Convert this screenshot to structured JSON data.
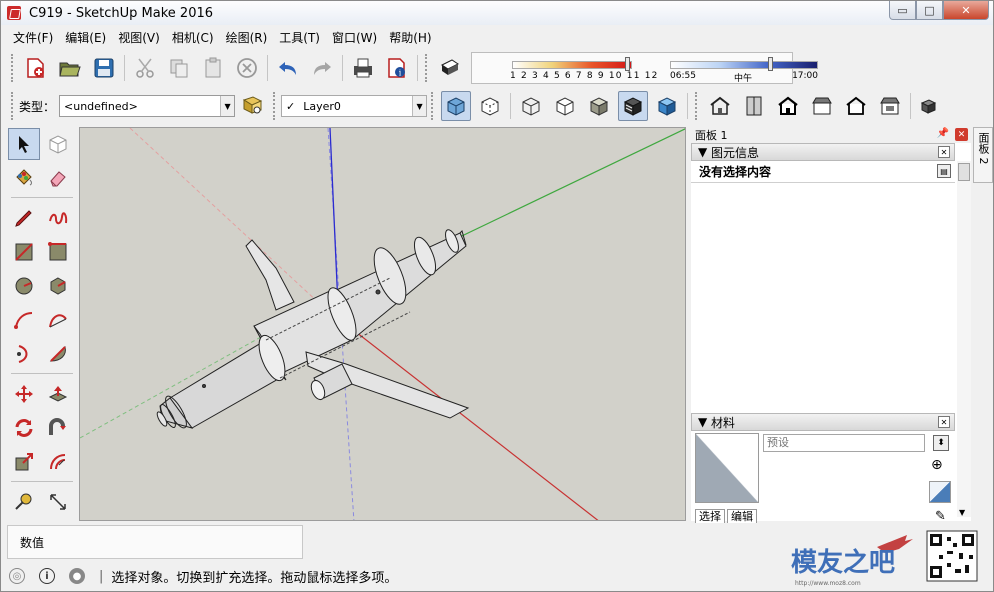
{
  "window": {
    "title": "C919 - SketchUp Make 2016",
    "min_glyph": "▭",
    "max_glyph": "□",
    "close_glyph": "✕"
  },
  "menu": [
    "文件(F)",
    "编辑(E)",
    "视图(V)",
    "相机(C)",
    "绘图(R)",
    "工具(T)",
    "窗口(W)",
    "帮助(H)"
  ],
  "toolbar": {
    "standard_icons": [
      "new-model-icon",
      "open-icon",
      "save-icon",
      "cut-icon",
      "copy-icon",
      "paste-icon",
      "erase-icon",
      "undo-icon",
      "redo-icon",
      "print-icon",
      "model-info-icon"
    ],
    "shadows": {
      "months": "1 2 3 4 5 6 7 8 9 10 11 12",
      "time_start": "06:55",
      "time_mid": "中午",
      "time_end": "17:00",
      "month_position": 0.97,
      "time_position": 0.68
    }
  },
  "toolbar2": {
    "type_label": "类型：",
    "type_value": "<undefined>",
    "layer_check": "✓",
    "layer_value": "Layer0",
    "style_icons": [
      "xray-icon",
      "back-edges-icon",
      "wireframe-icon",
      "hidden-line-icon",
      "shaded-icon",
      "shaded-textures-icon",
      "monochrome-icon"
    ],
    "view_icons": [
      "iso-view-icon",
      "top-view-icon",
      "front-view-icon",
      "right-view-icon",
      "back-view-icon",
      "left-view-icon",
      "components-icon"
    ]
  },
  "measurements": {
    "label": "数值"
  },
  "tray": {
    "title": "面板 1",
    "side_tab": "面板 2",
    "entity_info": {
      "header": "图元信息",
      "message": "没有选择内容"
    },
    "materials": {
      "header": "材料",
      "placeholder": "预设",
      "tabs": [
        "选择",
        "编辑"
      ]
    }
  },
  "status": {
    "text": "选择对象。切换到扩充选择。拖动鼠标选择多项。"
  },
  "watermark": {
    "brand": "模友之吧",
    "url": "http://www.moz8.com"
  },
  "colors": {
    "viewport_bg": "#d2d1ca",
    "axis_red": "#c83232",
    "axis_green": "#3fa83f",
    "axis_blue": "#2b2bd0",
    "active_button": "#c8d9ef"
  }
}
